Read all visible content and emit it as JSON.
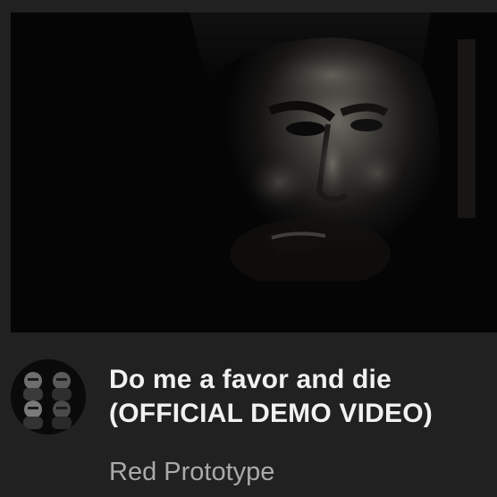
{
  "video": {
    "title_line1": "Do me a favor and die",
    "title_line2": "(OFFICIAL DEMO VIDEO)",
    "channel_name": "Red Prototype",
    "thumbnail": "dark-grayscale-face-closeup",
    "avatar": "four-band-members-portrait"
  },
  "colors": {
    "background": "#212121",
    "title": "#f1f1f1",
    "channel": "#aaaaaa",
    "thumbnail_bg": "#050505"
  }
}
